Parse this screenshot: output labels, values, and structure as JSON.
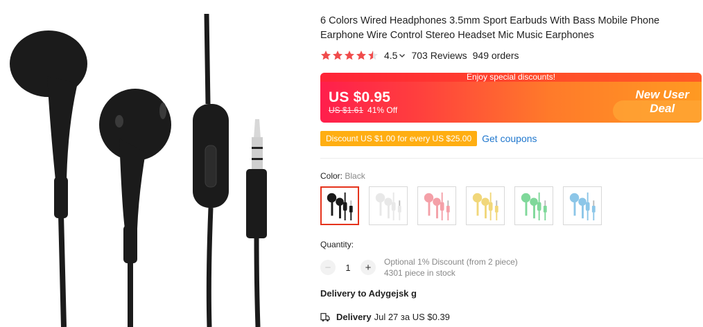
{
  "product": {
    "title": "6 Colors Wired Headphones 3.5mm Sport Earbuds With Bass Mobile Phone Earphone Wire Control Stereo Headset Mic Music Earphones",
    "image_icon": "black-earphones-image"
  },
  "rating": {
    "value": "4.5",
    "stars": 4.5,
    "stars_max": 5,
    "reviews": "703 Reviews",
    "orders": "949 orders",
    "star_color": "#f04b4b"
  },
  "price": {
    "banner_note": "Enjoy special discounts!",
    "current": "US $0.95",
    "original": "US $1.61",
    "discount": "41% Off",
    "new_user_line1": "New User",
    "new_user_line2": "Deal",
    "colors": {
      "start": "#ff1e4c",
      "end": "#ff9a22"
    }
  },
  "coupon": {
    "badge": "Discount US $1.00 for every US $25.00",
    "link": "Get coupons",
    "badge_color": "#ffae12",
    "link_color": "#2178ce"
  },
  "color": {
    "label": "Color:",
    "selected": "Black",
    "options": [
      {
        "name": "Black",
        "hex": "#1a1a1a"
      },
      {
        "name": "White",
        "hex": "#e8e8e8"
      },
      {
        "name": "Pink",
        "hex": "#f4a0a8"
      },
      {
        "name": "Yellow",
        "hex": "#f1d77a"
      },
      {
        "name": "Green",
        "hex": "#7fd89a"
      },
      {
        "name": "Blue",
        "hex": "#8cc6e8"
      }
    ]
  },
  "quantity": {
    "label": "Quantity:",
    "value": "1",
    "minus": "−",
    "plus": "+",
    "note1": "Optional 1% Discount (from 2 piece)",
    "note2": "4301 piece in stock"
  },
  "delivery": {
    "to": "Delivery to Adygejsk g",
    "label": "Delivery",
    "detail": "Jul 27 за US $0.39"
  }
}
